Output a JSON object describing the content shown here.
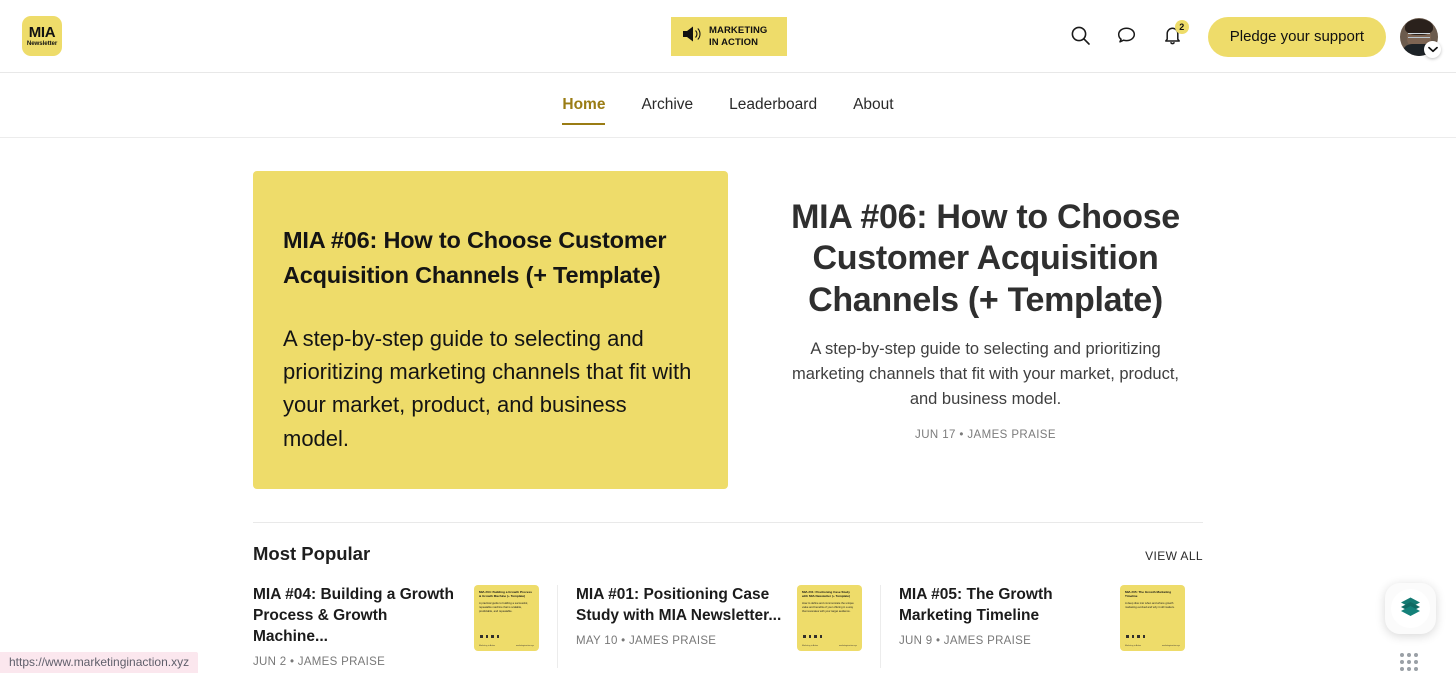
{
  "header": {
    "logo": {
      "line1": "MIA",
      "line2": "Newsletter"
    },
    "center_brand": {
      "line1": "MARKETING",
      "line2": "IN ACTION",
      "icon": "megaphone-icon"
    },
    "actions": {
      "search_label": "search-icon",
      "chat_label": "chat-bubble-icon",
      "notifications_label": "bell-icon",
      "notification_count": "2",
      "pledge_label": "Pledge your support"
    }
  },
  "nav": {
    "items": [
      {
        "label": "Home",
        "active": true
      },
      {
        "label": "Archive",
        "active": false
      },
      {
        "label": "Leaderboard",
        "active": false
      },
      {
        "label": "About",
        "active": false
      }
    ]
  },
  "hero": {
    "card": {
      "title": "MIA #06: How to Choose Customer Acquisition Channels (+ Template)",
      "body": "A step-by-step guide to selecting and prioritizing marketing channels that fit with your market, product, and business model."
    },
    "title": "MIA #06: How to Choose Customer Acquisition Channels (+ Template)",
    "subtitle": "A step-by-step guide to selecting and prioritizing marketing channels that fit with your market, product, and business model.",
    "meta": "JUN 17 • JAMES PRAISE"
  },
  "popular": {
    "heading": "Most Popular",
    "view_all": "VIEW ALL",
    "items": [
      {
        "title": "MIA #04: Building a Growth Process & Growth Machine...",
        "meta": "JUN 2 • JAMES PRAISE",
        "thumb_title": "MIA #04: Building a Growth Process & Growth Machine (+ Template)",
        "thumb_body": "A practical guide to building a successful, repeatable machine that is scalable, predictable, and repeatable.",
        "thumb_foot_left": "Marketing in Action",
        "thumb_foot_right": "marketinginaction.xyz"
      },
      {
        "title": "MIA #01: Positioning Case Study with MIA Newsletter...",
        "meta": "MAY 10 • JAMES PRAISE",
        "thumb_title": "MIA #01: Positioning Case Study with MIA Newsletter (+ Template)",
        "thumb_body": "How to define and communicate the unique value and benefits of your offering in a way that resonates with your target audience.",
        "thumb_foot_left": "Marketing in Action",
        "thumb_foot_right": "marketinginaction.xyz"
      },
      {
        "title": "MIA #05: The Growth Marketing Timeline",
        "meta": "JUN 9 • JAMES PRAISE",
        "thumb_title": "MIA #05: The Growth Marketing Timeline",
        "thumb_body": "A deep dive into when and where growth marketing evolved and why it still matters.",
        "thumb_foot_left": "Marketing in Action",
        "thumb_foot_right": "marketinginaction.xyz"
      }
    ]
  },
  "floating_widget": {
    "icon": "book-stack-icon"
  },
  "status_bar": {
    "url": "https://www.marketinginaction.xyz"
  },
  "colors": {
    "brand_yellow": "#eedc6a",
    "nav_active": "#9a7c14",
    "widget_teal": "#147a72",
    "status_bg": "#fbe7ee"
  }
}
